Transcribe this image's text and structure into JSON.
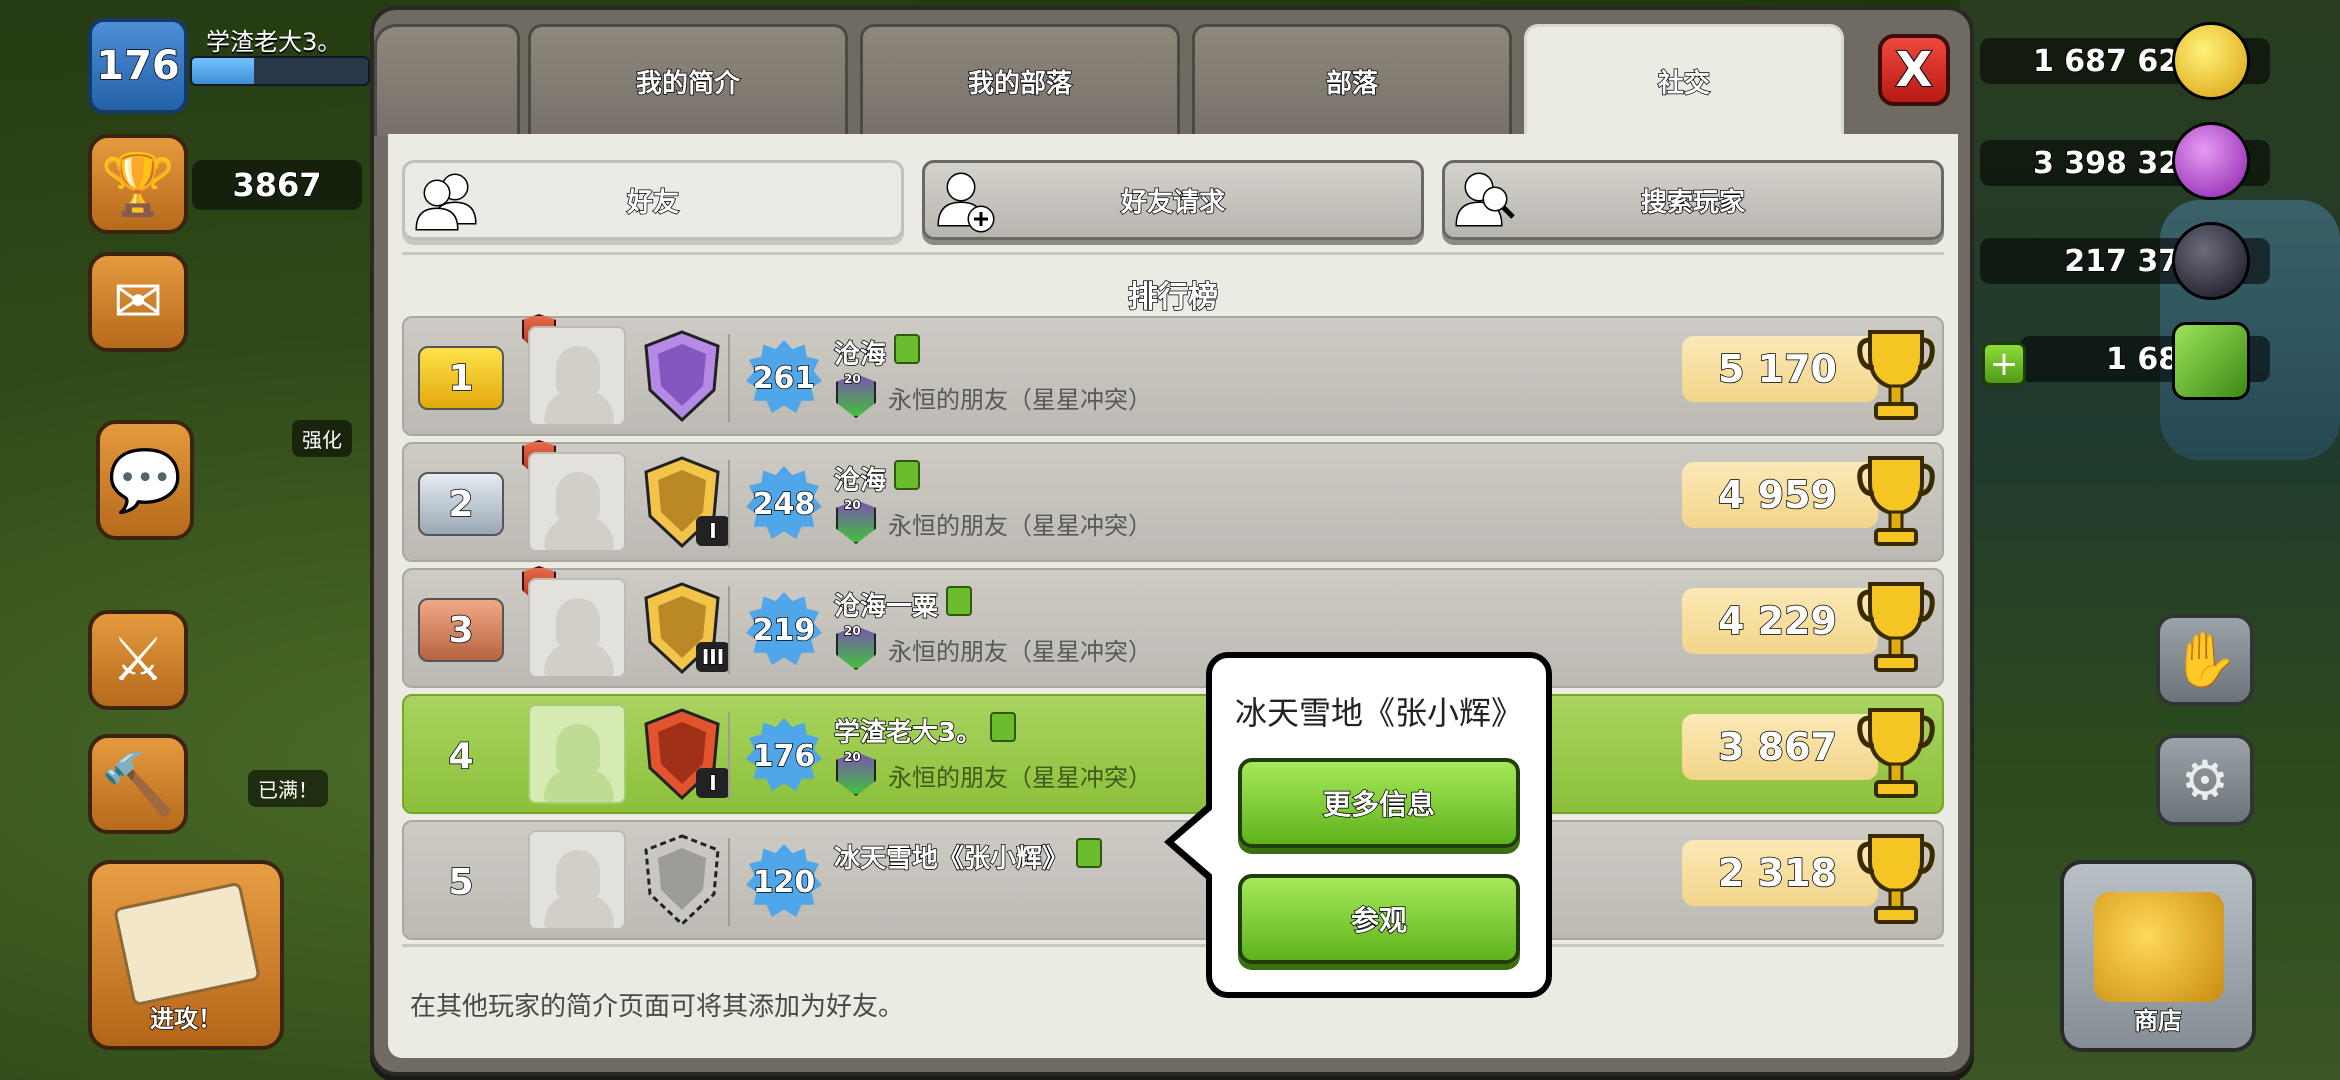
{
  "hud": {
    "player_level": "176",
    "player_name": "学渣老大3。",
    "xp_fill_percent": 35,
    "trophies": "3867",
    "upgrade_label": "强化",
    "full_label": "已满！",
    "attack_label": "进攻！",
    "shop_label": "商店",
    "gold": "1 687 620",
    "elixir": "3 398 320",
    "dark_elixir": "217 375",
    "gems": "1 681",
    "gem_plus": "+"
  },
  "tabs": [
    {
      "label": "我的简介"
    },
    {
      "label": "我的部落"
    },
    {
      "label": "部落"
    },
    {
      "label": "社交",
      "active": true
    }
  ],
  "close_label": "X",
  "subtabs": {
    "friends": "好友",
    "friend_requests": "好友请求",
    "search_players": "搜索玩家"
  },
  "board_title": "排行榜",
  "rows": [
    {
      "rank": "1",
      "xp": "261",
      "name": "沧海",
      "clan": "永恒的朋友（星星冲突）",
      "trophies": "5 170",
      "league_level": ""
    },
    {
      "rank": "2",
      "xp": "248",
      "name": "沧海",
      "clan": "永恒的朋友（星星冲突）",
      "trophies": "4 959",
      "league_level": "I"
    },
    {
      "rank": "3",
      "xp": "219",
      "name": "沧海一粟",
      "clan": "永恒的朋友（星星冲突）",
      "trophies": "4 229",
      "league_level": "III"
    },
    {
      "rank": "4",
      "xp": "176",
      "name": "学渣老大3。",
      "clan": "永恒的朋友（星星冲突）",
      "trophies": "3 867",
      "league_level": "I"
    },
    {
      "rank": "5",
      "xp": "120",
      "name": "冰天雪地《张小辉》",
      "clan": "",
      "trophies": "2 318",
      "league_level": ""
    }
  ],
  "clan_badge_level": "20",
  "footer": "在其他玩家的简介页面可将其添加为好友。",
  "popup": {
    "title": "冰天雪地《张小辉》",
    "more_info": "更多信息",
    "visit": "参观"
  },
  "colors": {
    "panel_bg": "#ebeae3",
    "highlight_row": "#9ccb4c",
    "gold_rank": "#f2c21e",
    "green_button": "#7ccc2e",
    "close_red": "#e0332a"
  }
}
